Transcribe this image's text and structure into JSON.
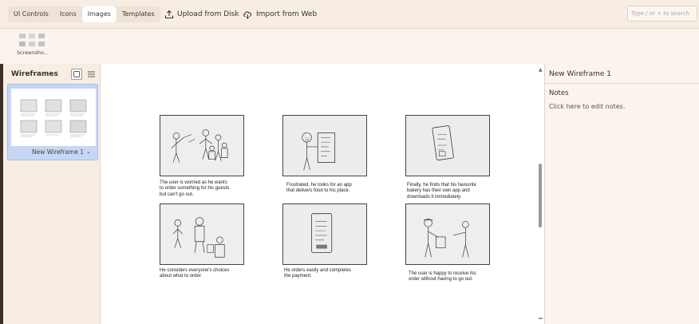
{
  "toolbar": {
    "tabs": [
      {
        "label": "UI Controls"
      },
      {
        "label": "Icons"
      },
      {
        "label": "Images"
      },
      {
        "label": "Templates"
      }
    ],
    "active_tab": "Images",
    "upload_label": "Upload from Disk",
    "import_label": "Import from Web",
    "search_placeholder": "Type / or + to search"
  },
  "assets": {
    "items": [
      {
        "label": "Screensho..."
      }
    ]
  },
  "left_panel": {
    "title": "Wireframes",
    "wireframes": [
      {
        "label": "New Wireframe 1"
      }
    ]
  },
  "canvas": {
    "frames": [
      {
        "caption": "The user is worried as he wants\nto order something for his guests\nbut can't go out."
      },
      {
        "caption": "Frustrated, he looks for an app\nthat delivers food to his place."
      },
      {
        "caption": "Finally, he finds that his favourite\nbakery has their own app and\ndownloads it immediately."
      },
      {
        "caption": "He considers everyone's choices\nabout what to order."
      },
      {
        "caption": "He orders easily and completes\nthe payment."
      },
      {
        "caption": "The user is happy to receive his\norder without having to go out."
      }
    ]
  },
  "right_panel": {
    "title": "New Wireframe 1",
    "notes_heading": "Notes",
    "notes_placeholder": "Click here to edit notes."
  }
}
